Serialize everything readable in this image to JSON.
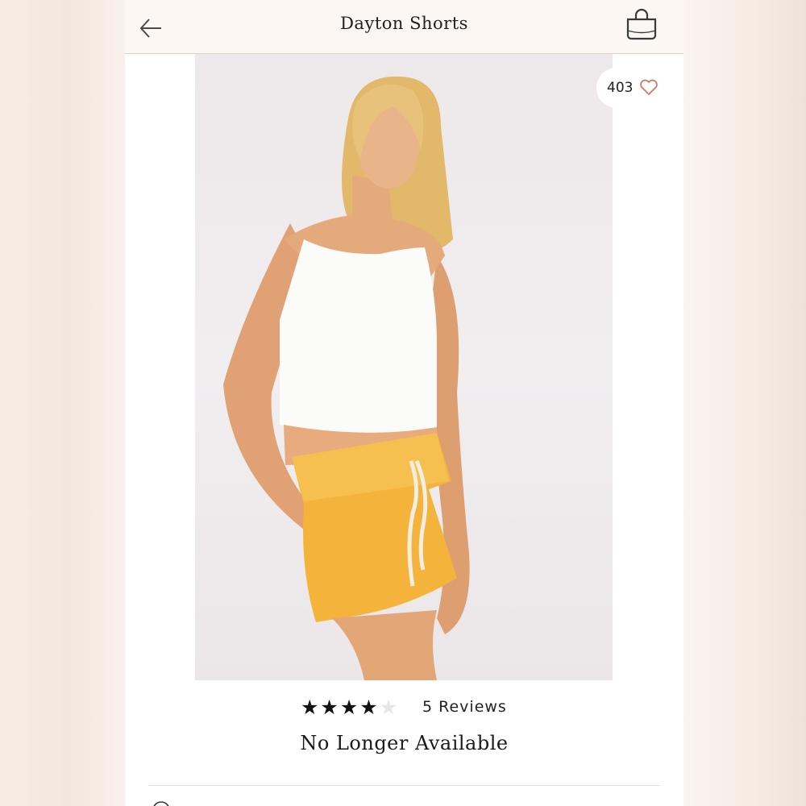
{
  "header": {
    "title": "Dayton Shorts",
    "back_icon": "arrow-left-icon",
    "bag_icon": "shopping-bag-icon"
  },
  "product_image": {
    "likes_count": "403",
    "heart_icon": "heart-outline-icon",
    "heart_color": "#d07a6a"
  },
  "rating": {
    "stars_filled": 4,
    "stars_total": 5,
    "reviews_label": "5 Reviews"
  },
  "availability": {
    "status": "No Longer Available"
  },
  "colors": {
    "accent_heart": "#d07a6a",
    "shorts": "#f4b33a",
    "text": "#1f1f1f"
  }
}
